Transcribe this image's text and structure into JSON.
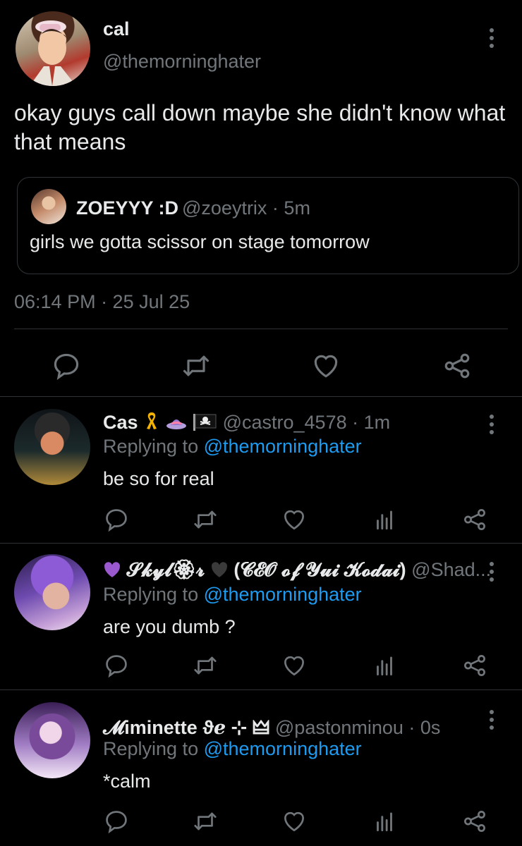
{
  "main_tweet": {
    "display_name": "cal",
    "handle": "@themorninghater",
    "text": "okay guys call down maybe she didn't know what that means",
    "timestamp": "06:14 PM · 25 Jul 25",
    "quoted": {
      "display_name": "ZOEYYY :D",
      "meta": "@zoeytrix · 5m",
      "text": "girls we gotta scissor on stage tomorrow"
    }
  },
  "replies": [
    {
      "display_name": "Cas",
      "meta": "@castro_4578 · 1m",
      "replying_prefix": "Replying to",
      "replying_handle": "@themorninghater",
      "text": "be so for real"
    },
    {
      "display_name": "𝓢𝓴𝔂𝓵🏵𝓻",
      "display_name_suffix": "(𝓒𝓔𝓞 𝓸𝓯 𝓨𝓾𝓲 𝓚𝓸𝓭𝓪𝓲)",
      "meta": "@Shad...",
      "replying_prefix": "Replying to",
      "replying_handle": "@themorninghater",
      "text": "are you dumb ?"
    },
    {
      "display_name": "𝓜iminette",
      "display_name_suffix": "ϑℯ ⊹ 🜲",
      "meta": "@pastonminou · 0s",
      "replying_prefix": "Replying to",
      "replying_handle": "@themorninghater",
      "text": "*calm"
    }
  ],
  "icons": {
    "reply": "speech-bubble-icon",
    "retweet": "retweet-icon",
    "like": "heart-icon",
    "views": "bar-chart-icon",
    "share": "share-nodes-icon",
    "more": "more-vertical-icon"
  },
  "colors": {
    "background": "#000000",
    "text": "#e7e9ea",
    "secondary": "#71767b",
    "link": "#1d9bf0",
    "divider": "#2f3336"
  }
}
